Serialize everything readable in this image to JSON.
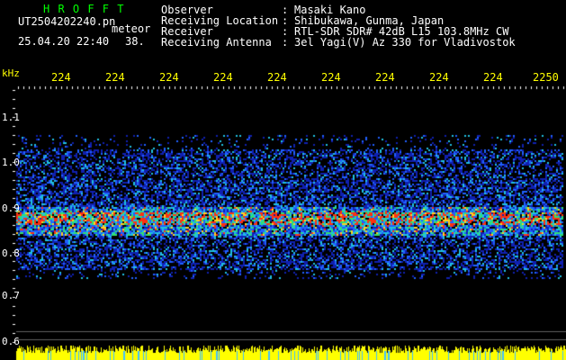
{
  "header": {
    "app_logo_text": "H R O F F T",
    "filename": "UT2504202240.pn",
    "mode": "meteor",
    "date_time": "25.04.20 22:40",
    "counter": "38.",
    "info": {
      "observer_label": "Observer",
      "observer_value": "Masaki Kano",
      "location_label": "Receiving Location",
      "location_value": "Shibukawa, Gunma, Japan",
      "receiver_label": "Receiver",
      "receiver_value": "RTL-SDR SDR# 42dB L15 103.8MHz CW",
      "antenna_label": "Receiving Antenna",
      "antenna_value": "3el Yagi(V) Az 330 for Vladivostok",
      "separator": ":"
    }
  },
  "time_axis": [
    "224",
    "224",
    "224",
    "224",
    "224",
    "224",
    "224",
    "224",
    "224",
    "2250"
  ],
  "freq_axis": {
    "unit": "kHz",
    "labels": [
      "1.1",
      "1.0",
      "0.9",
      "0.8",
      "0.7",
      "0.6"
    ]
  },
  "colors": {
    "background": "#000000",
    "text": "#ffffff",
    "time_labels": "#ffff00",
    "logo": "#00ff00",
    "noise_band": "#ffff00"
  }
}
